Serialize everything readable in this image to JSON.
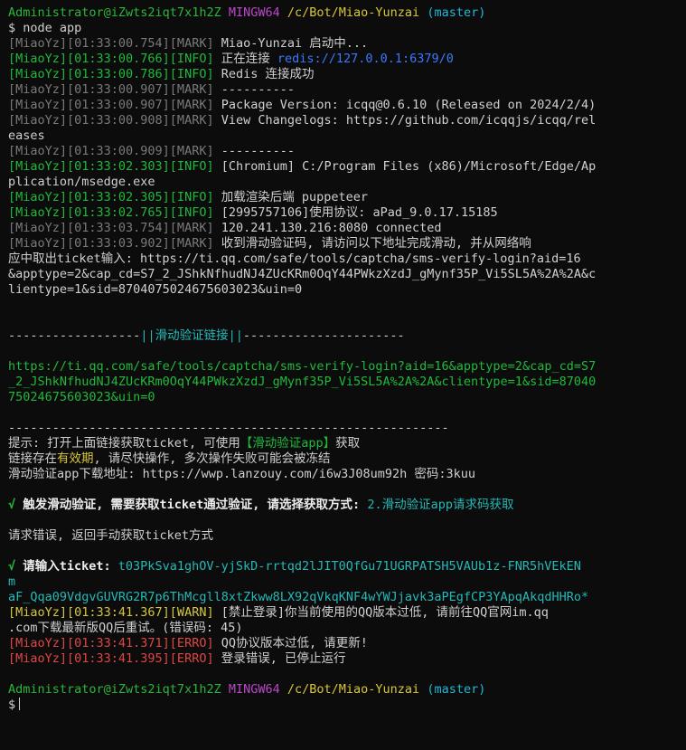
{
  "colors": {
    "background": "#0c0c0c",
    "text": "#d0d0d0",
    "green": "#22b83c",
    "yellow": "#d8c63a",
    "gray": "#7a7a7a",
    "red": "#e04646",
    "cyan": "#26b8b8",
    "magenta": "#b948c8",
    "link_blue": "#3b78ff"
  },
  "prompt1": {
    "user": "Administrator@iZwts2iqt7x1h2Z",
    "shell": "MINGW64",
    "path": "/c/Bot/Miao-Yunzai",
    "branch": "(master)"
  },
  "cmd1": "$ node app",
  "logs": [
    {
      "tag": "[MiaoYz][01:33:00.754][MARK]",
      "msg": " Miao-Yunzai 启动中..."
    },
    {
      "tag": "[MiaoYz][01:33:00.766][INFO]",
      "msg": " 正在连接 ",
      "link": "redis://127.0.0.1:6379/0"
    },
    {
      "tag": "[MiaoYz][01:33:00.786][INFO]",
      "msg": " Redis 连接成功"
    },
    {
      "tag": "[MiaoYz][01:33:00.907][MARK]",
      "msg": " ----------"
    },
    {
      "tag": "[MiaoYz][01:33:00.907][MARK]",
      "msg": " Package Version: icqq@0.6.10 (Released on 2024/2/4)"
    },
    {
      "tag": "[MiaoYz][01:33:00.908][MARK]",
      "msg": " View Changelogs: https://github.com/icqqjs/icqq/rel"
    },
    {
      "cont": "eases"
    },
    {
      "tag": "[MiaoYz][01:33:00.909][MARK]",
      "msg": " ----------"
    },
    {
      "tag": "[MiaoYz][01:33:02.303][INFO]",
      "msg": " [Chromium] C:/Program Files (x86)/Microsoft/Edge/Ap"
    },
    {
      "cont": "plication/msedge.exe"
    },
    {
      "tag": "[MiaoYz][01:33:02.305][INFO]",
      "msg": " 加载渲染后端 puppeteer"
    },
    {
      "tag": "[MiaoYz][01:33:02.765][INFO]",
      "msg": " [2995757106]使用协议: aPad_9.0.17.15185"
    },
    {
      "tag": "[MiaoYz][01:33:03.754][MARK]",
      "msg": " 120.241.130.216:8080 connected"
    },
    {
      "tag": "[MiaoYz][01:33:03.902][MARK]",
      "msg": " 收到滑动验证码, 请访问以下地址完成滑动, 并从网络响"
    },
    {
      "cont": "应中取出ticket输入: https://ti.qq.com/safe/tools/captcha/sms-verify-login?aid=16"
    },
    {
      "cont": "&apptype=2&cap_cd=S7_2_JShkNfhudNJ4ZUcKRm0OqY44PWkzXzdJ_gMynf35P_Vi5SL5A%2A%2A&c"
    },
    {
      "cont": "lientype=1&sid=8704075024675603023&uin=0"
    }
  ],
  "banner": {
    "dashes_left": "------------------",
    "title": "||滑动验证链接||",
    "dashes_right": "----------------------"
  },
  "captcha_url": [
    "https://ti.qq.com/safe/tools/captcha/sms-verify-login?aid=16&apptype=2&cap_cd=S7",
    "_2_JShkNfhudNJ4ZUcKRm0OqY44PWkzXzdJ_gMynf35P_Vi5SL5A%2A%2A&clientype=1&sid=87040",
    "75024675603023&uin=0"
  ],
  "divider": "------------------------------------------------------------",
  "tips": {
    "l1_a": "提示: 打开上面链接获取ticket, 可使用",
    "l1_b": "【滑动验证app】",
    "l1_c": "获取",
    "l2_a": "链接存在",
    "l2_b": "有效期",
    "l2_c": ", 请尽快操作, 多次操作失败可能会被冻结",
    "l3": "滑动验证app下载地址: https://wwp.lanzouy.com/i6w3J08um92h 密码:3kuu"
  },
  "trigger": {
    "mark": "√",
    "text": " 触发滑动验证, 需要获取ticket通过验证, 请选择获取方式:",
    "choice": " 2.滑动验证app请求码获取"
  },
  "request_error": "请求错误, 返回手动获取ticket方式",
  "ticket": {
    "mark": "√",
    "label": " 请输入ticket:",
    "value_lines": [
      " t03PkSva1ghOV-yjSkD-rrtqd2lJIT0QfGu71UGRPATSH5VAUb1z-FNR5hVEkEN",
      "m",
      "aF_Qqa09VdgvGUVRG2R7p6ThMcgll8xtZkww8LX92qVkqKNF4wYWJjavk3aPEgfCP3YApqAkqdHHRo*"
    ]
  },
  "warn": {
    "tag": "[MiaoYz][01:33:41.367][WARN]",
    "msg": " [禁止登录]你当前使用的QQ版本过低, 请前往QQ官网im.qq",
    "cont": ".com下载最新版QQ后重试。(错误码: 45)"
  },
  "errors": [
    {
      "tag": "[MiaoYz][01:33:41.371][ERRO]",
      "msg": " QQ协议版本过低, 请更新!"
    },
    {
      "tag": "[MiaoYz][01:33:41.395][ERRO]",
      "msg": " 登录错误, 已停止运行"
    }
  ],
  "prompt2": {
    "user": "Administrator@iZwts2iqt7x1h2Z",
    "shell": "MINGW64",
    "path": "/c/Bot/Miao-Yunzai",
    "branch": "(master)"
  },
  "cmd2": "$"
}
